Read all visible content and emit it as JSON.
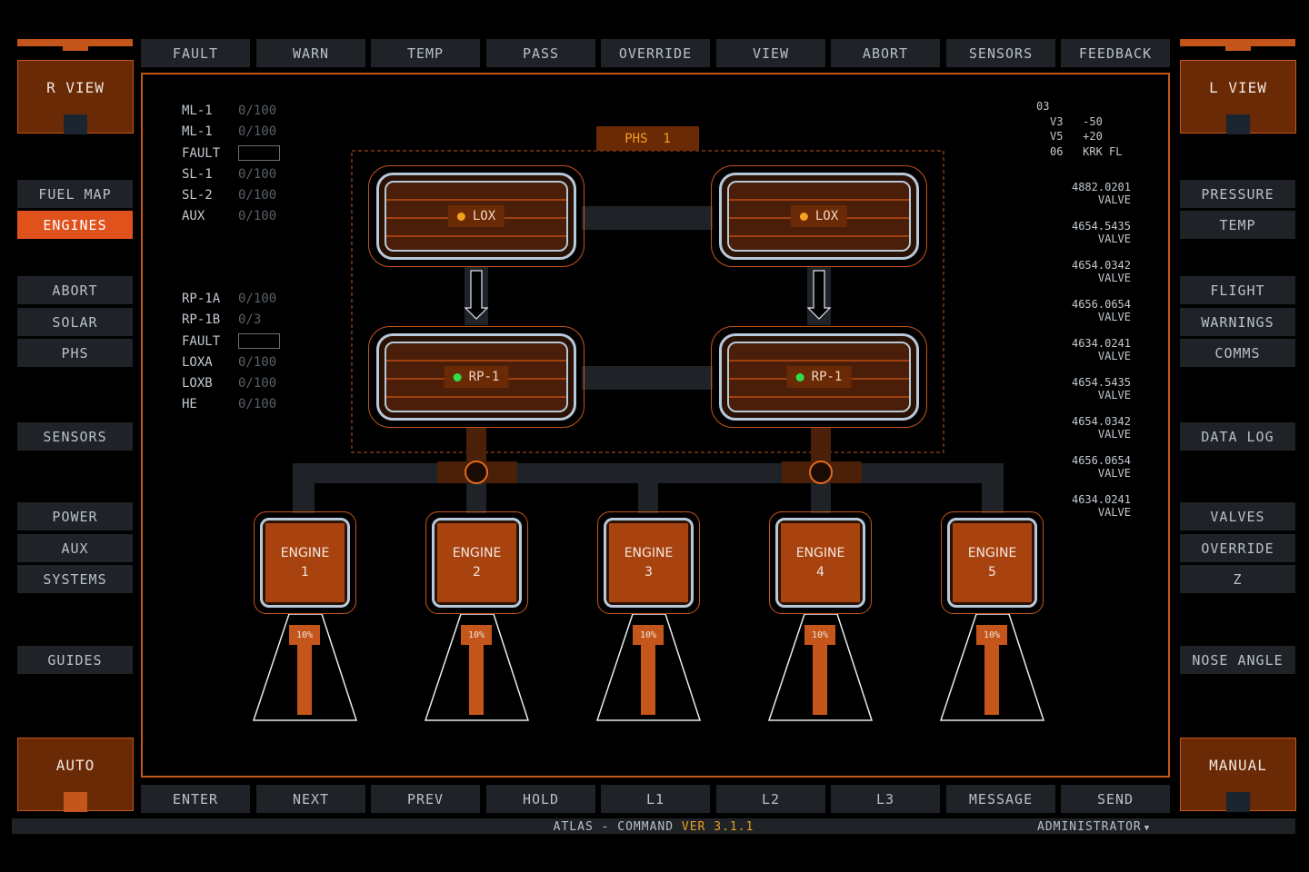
{
  "top_nav": [
    "FAULT",
    "WARN",
    "TEMP",
    "PASS",
    "OVERRIDE",
    "VIEW",
    "ABORT",
    "SENSORS",
    "FEEDBACK"
  ],
  "bottom_nav": [
    "ENTER",
    "NEXT",
    "PREV",
    "HOLD",
    "L1",
    "L2",
    "L3",
    "MESSAGE",
    "SEND"
  ],
  "corners": {
    "top_left": "R VIEW",
    "top_right": "L VIEW",
    "bottom_left": "AUTO",
    "bottom_right": "MANUAL"
  },
  "left_menu": {
    "group1": [
      "FUEL MAP",
      "ENGINES"
    ],
    "active": "ENGINES",
    "group2": [
      "ABORT",
      "SOLAR",
      "PHS"
    ],
    "group3": [
      "SENSORS"
    ],
    "group4": [
      "POWER",
      "AUX",
      "SYSTEMS"
    ],
    "group5": [
      "GUIDES"
    ]
  },
  "right_menu": {
    "group1": [
      "PRESSURE",
      "TEMP"
    ],
    "group2": [
      "FLIGHT",
      "WARNINGS",
      "COMMS"
    ],
    "group3": [
      "DATA LOG"
    ],
    "group4": [
      "VALVES",
      "OVERRIDE",
      "Z"
    ],
    "group5": [
      "NOSE ANGLE"
    ]
  },
  "legend_top": [
    {
      "key": "ML-1",
      "value": "0/100"
    },
    {
      "key": "ML-1",
      "value": "0/100"
    },
    {
      "key": "FAULT",
      "value": ""
    },
    {
      "key": "SL-1",
      "value": "0/100"
    },
    {
      "key": "SL-2",
      "value": "0/100"
    },
    {
      "key": "AUX",
      "value": "0/100"
    }
  ],
  "legend_bottom": [
    {
      "key": "RP-1A",
      "value": "0/100"
    },
    {
      "key": "RP-1B",
      "value": "0/3"
    },
    {
      "key": "FAULT",
      "value": ""
    },
    {
      "key": "LOXA",
      "value": "0/100"
    },
    {
      "key": "LOXB",
      "value": "0/100"
    },
    {
      "key": "HE",
      "value": "0/100"
    }
  ],
  "header_readout": {
    "line1": "03",
    "line2": "V3   -50",
    "line3": "V5   +20",
    "line4": "06   KRK FL"
  },
  "values": [
    {
      "num": "4882.0201",
      "label": "VALVE"
    },
    {
      "num": "4654.5435",
      "label": "VALVE"
    },
    {
      "num": "4654.0342",
      "label": "VALVE"
    },
    {
      "num": "4656.0654",
      "label": "VALVE"
    },
    {
      "num": "4634.0241",
      "label": "VALVE"
    },
    {
      "num": "4654.5435",
      "label": "VALVE"
    },
    {
      "num": "4654.0342",
      "label": "VALVE"
    },
    {
      "num": "4656.0654",
      "label": "VALVE"
    },
    {
      "num": "4634.0241",
      "label": "VALVE"
    }
  ],
  "phase_label": "PHS  1",
  "tanks": [
    {
      "label": "LOX",
      "color": "#f5a01e"
    },
    {
      "label": "LOX",
      "color": "#f5a01e"
    },
    {
      "label": "RP-1",
      "color": "#2ee04a"
    },
    {
      "label": "RP-1",
      "color": "#2ee04a"
    }
  ],
  "engines": [
    {
      "name": "ENGINE",
      "num": "1",
      "throttle": "10%",
      "throttle_pct": 10
    },
    {
      "name": "ENGINE",
      "num": "2",
      "throttle": "10%",
      "throttle_pct": 10
    },
    {
      "name": "ENGINE",
      "num": "3",
      "throttle": "10%",
      "throttle_pct": 10
    },
    {
      "name": "ENGINE",
      "num": "4",
      "throttle": "10%",
      "throttle_pct": 10
    },
    {
      "name": "ENGINE",
      "num": "5",
      "throttle": "10%",
      "throttle_pct": 10
    }
  ],
  "status": {
    "app": "ATLAS - COMMAND",
    "version": "VER 3.1.1",
    "user": "ADMINISTRATOR"
  },
  "colors": {
    "accent": "#c4561b",
    "active": "#e0521c",
    "panel": "#1f2328",
    "version": "#e8a020"
  }
}
